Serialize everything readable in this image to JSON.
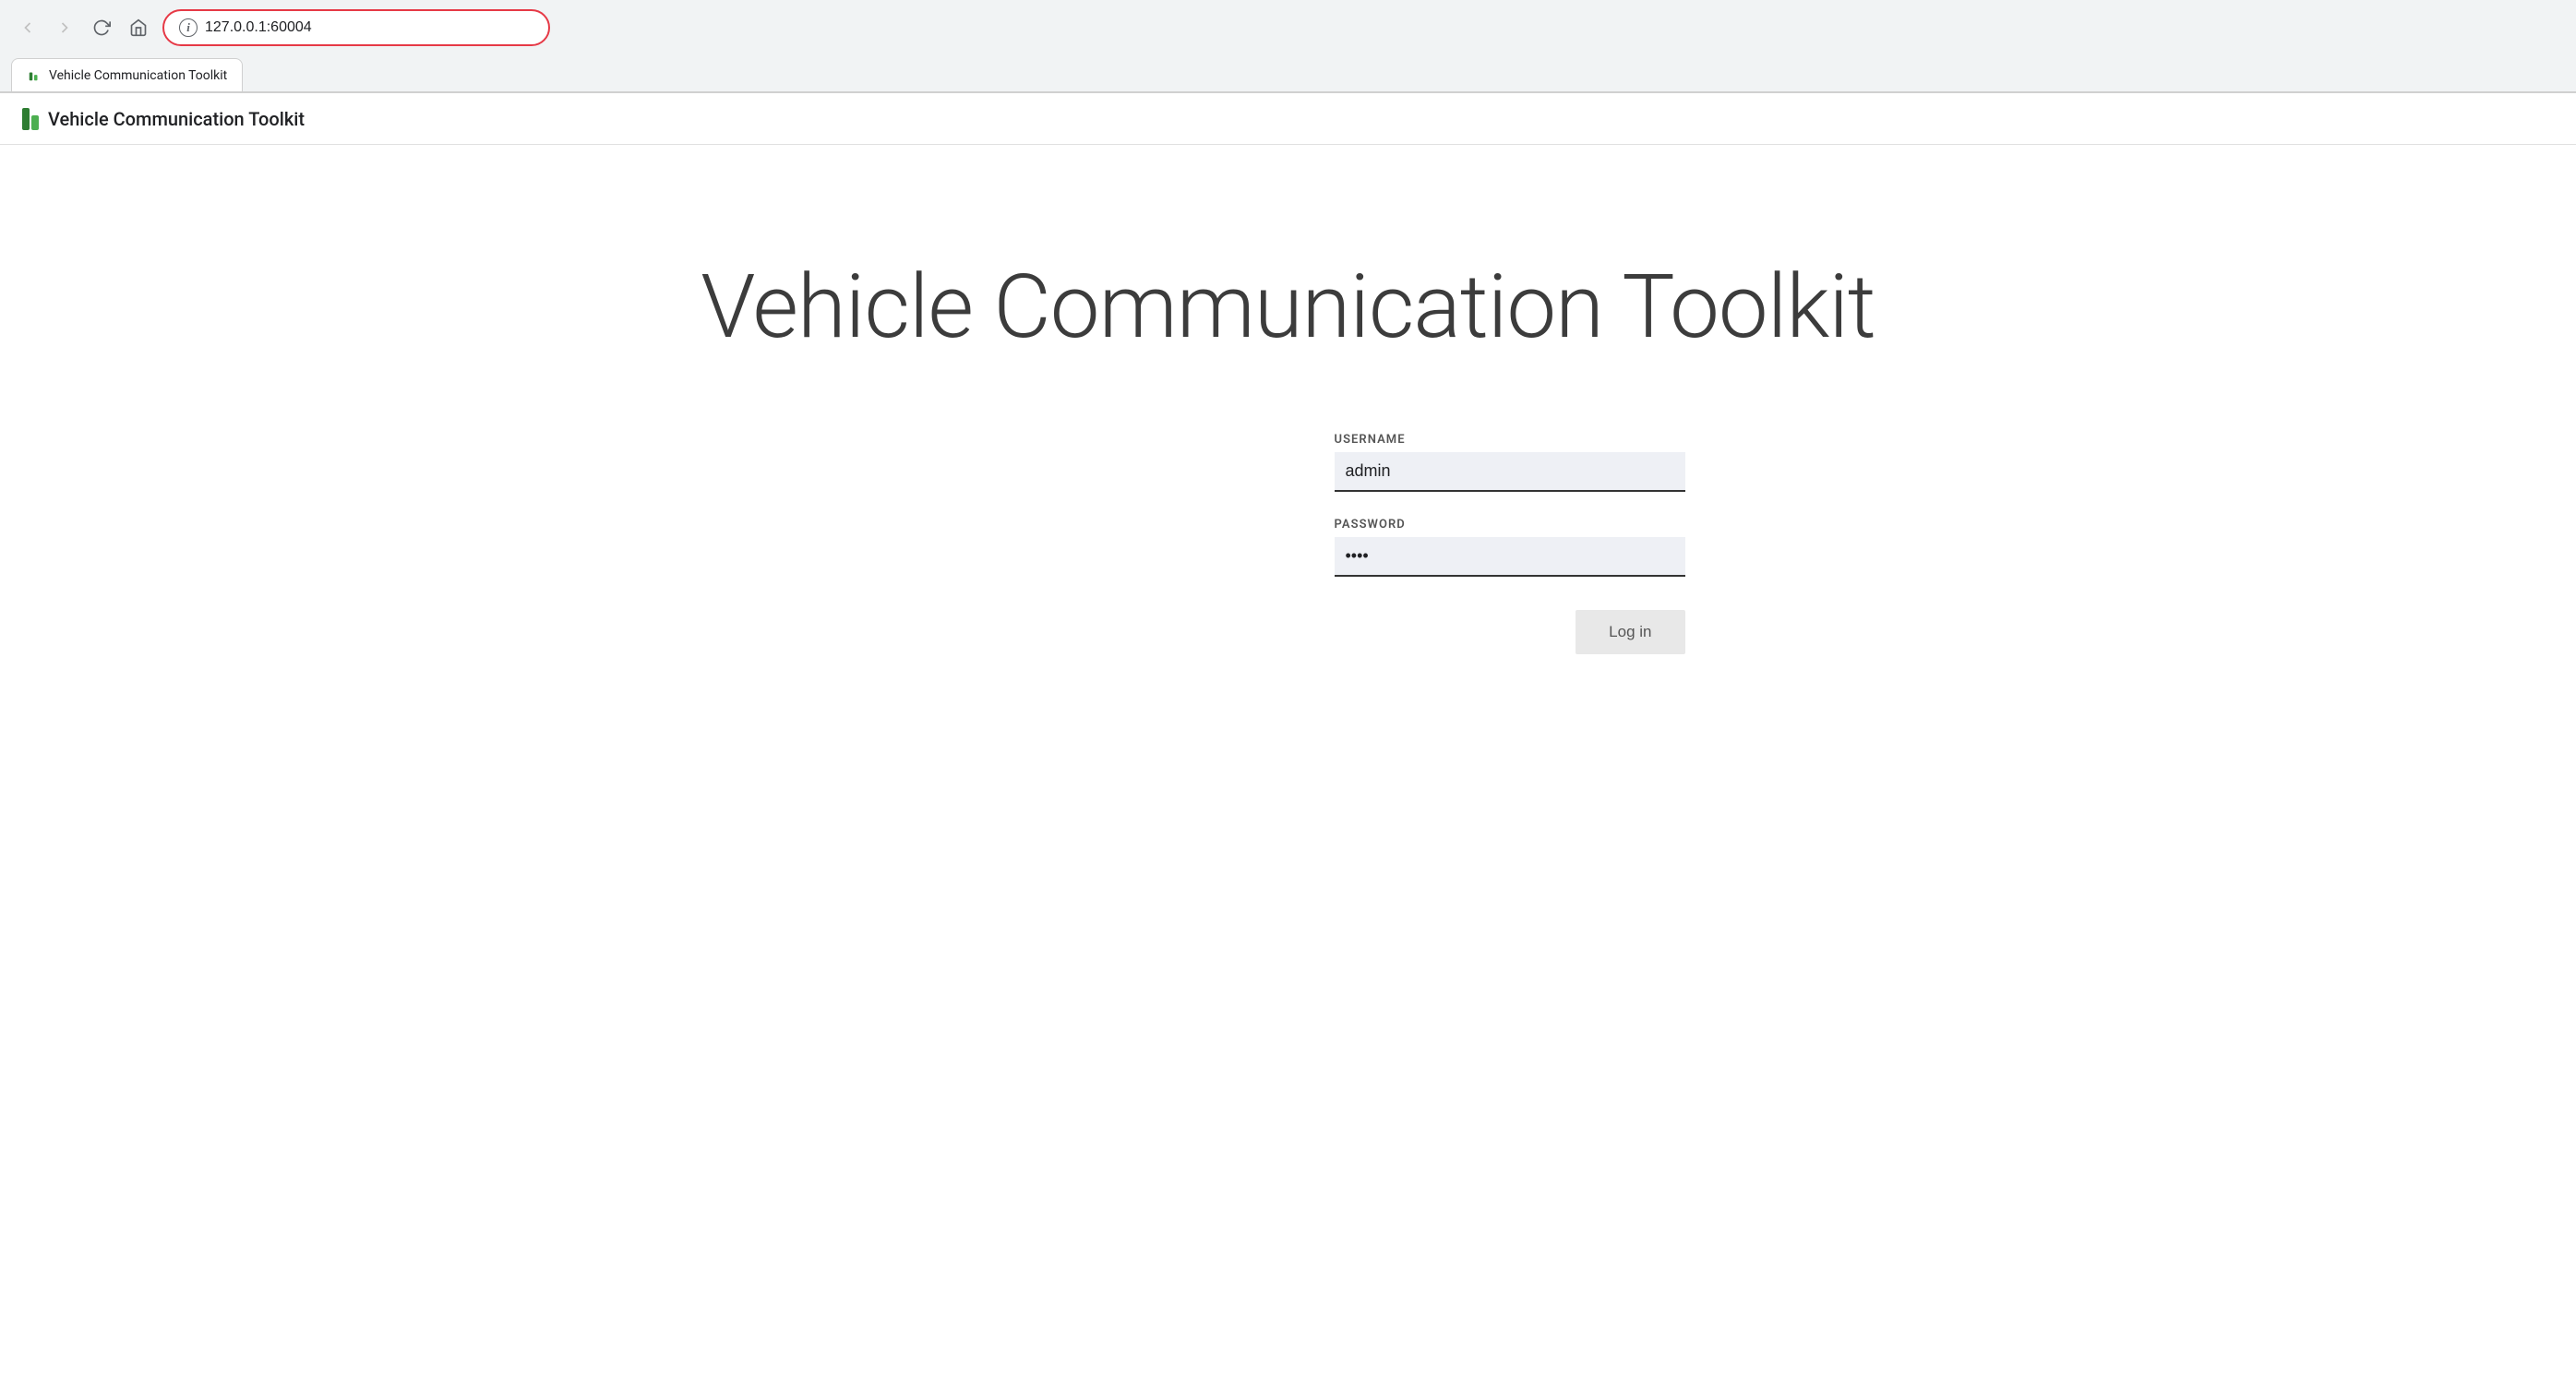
{
  "browser": {
    "address": "127.0.0.1",
    "port": ":60004",
    "full_address": "127.0.0.1:60004",
    "info_icon_label": "i",
    "tab_title": "Vehicle Communication Toolkit"
  },
  "navbar": {
    "app_title": "Vehicle Communication Toolkit",
    "logo_alt": "VCT logo"
  },
  "page": {
    "heading": "Vehicle Communication Toolkit"
  },
  "login": {
    "username_label": "USERNAME",
    "username_value": "admin",
    "password_label": "PASSWORD",
    "password_placeholder": "••••",
    "login_button": "Log in"
  }
}
